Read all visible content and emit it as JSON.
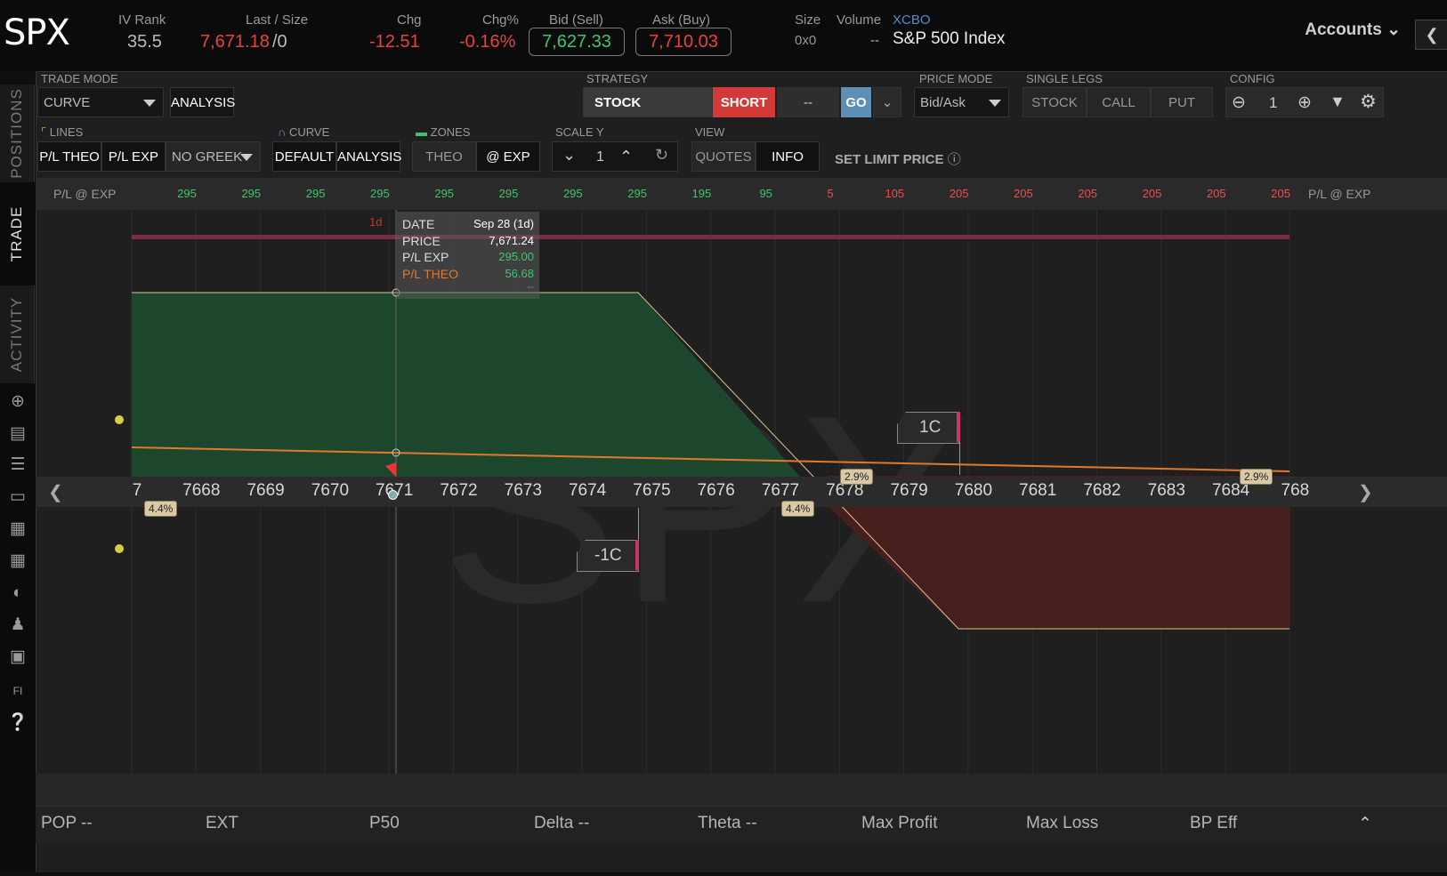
{
  "header": {
    "symbol": "SPX",
    "iv_rank_label": "IV Rank",
    "iv_rank": "35.5",
    "last_size_label": "Last / Size",
    "last": "7,671.18",
    "size": "/0",
    "chg_label": "Chg",
    "chg": "-12.51",
    "chgpct_label": "Chg%",
    "chgpct": "-0.16%",
    "bid_label": "Bid (Sell)",
    "bid": "7,627.33",
    "ask_label": "Ask (Buy)",
    "ask": "7,710.03",
    "size_label": "Size",
    "size_val": "0x0",
    "volume_label": "Volume",
    "volume": "--",
    "exchange": "XCBO",
    "name": "S&P 500 Index",
    "accounts": "Accounts"
  },
  "sidebar": {
    "tabs": [
      "POSITIONS",
      "TRADE",
      "ACTIVITY"
    ],
    "icons": [
      "crosshair-icon",
      "chart-icon",
      "list-icon",
      "tv-icon",
      "grid-chart-icon",
      "dashboard-icon",
      "gauge-icon",
      "people-icon",
      "calendar-icon",
      "fi-icon",
      "help-icon"
    ]
  },
  "toolbar": {
    "trade_mode_label": "TRADE MODE",
    "trade_mode": "CURVE",
    "analysis": "ANALYSIS",
    "strategy_label": "STRATEGY",
    "strategy": "STOCK",
    "short": "SHORT",
    "dash": "--",
    "go": "GO",
    "price_mode_label": "PRICE MODE",
    "price_mode": "Bid/Ask",
    "single_legs_label": "SINGLE LEGS",
    "leg_stock": "STOCK",
    "leg_call": "CALL",
    "leg_put": "PUT",
    "config_label": "CONFIG",
    "config_val": "1",
    "lines_label": "LINES",
    "pl_theo": "P/L THEO",
    "pl_exp": "P/L EXP",
    "no_greek": "NO GREEK",
    "curve_label": "CURVE",
    "curve_default": "DEFAULT",
    "curve_analysis": "ANALYSIS",
    "zones_label": "ZONES",
    "zones_theo": "THEO",
    "zones_exp": "@ EXP",
    "scale_label": "SCALE Y",
    "scale_val": "1",
    "view_label": "VIEW",
    "view_quotes": "QUOTES",
    "view_info": "INFO",
    "set_limit": "SET LIMIT PRICE"
  },
  "chart": {
    "pl_row_label": "P/L @ EXP",
    "pl_values": [
      "295",
      "295",
      "295",
      "295",
      "295",
      "295",
      "295",
      "295",
      "195",
      "95",
      "5",
      "105",
      "205",
      "205",
      "205",
      "205",
      "205",
      "205"
    ],
    "pl_colors": [
      "g",
      "g",
      "g",
      "g",
      "g",
      "g",
      "g",
      "g",
      "g",
      "g",
      "r",
      "r",
      "r",
      "r",
      "r",
      "r",
      "r",
      "r"
    ],
    "prices": [
      "7",
      "7668",
      "7669",
      "7670",
      "7671",
      "7672",
      "7673",
      "7674",
      "7675",
      "7676",
      "7677",
      "7678",
      "7679",
      "7680",
      "7681",
      "7682",
      "7683",
      "7684",
      "768"
    ],
    "watermark": "SPX",
    "tooltip": {
      "date_label": "DATE",
      "date": "Sep 28 (1d)",
      "price_label": "PRICE",
      "price": "7,671.24",
      "plexp_label": "P/L EXP",
      "plexp": "295.00",
      "pltheo_label": "P/L THEO",
      "pltheo": "56.68",
      "extra": "--"
    },
    "day_markers": [
      "1d",
      "1d"
    ],
    "leg_short": "1C",
    "leg_long": "-1C",
    "pct_left": "4.4%",
    "pct_mid": "4.4%",
    "pct_right1": "2.9%",
    "pct_right2": "2.9%"
  },
  "bottom": {
    "pop": "POP --",
    "ext": "EXT",
    "p50": "P50",
    "delta": "Delta --",
    "theta": "Theta --",
    "max_profit": "Max Profit",
    "max_loss": "Max Loss",
    "bp_eff": "BP Eff"
  },
  "colors": {
    "profit": "#1e4a2e",
    "loss": "#4a1f1f",
    "accent": "#ee3f3f",
    "go": "#5f8fb5"
  }
}
